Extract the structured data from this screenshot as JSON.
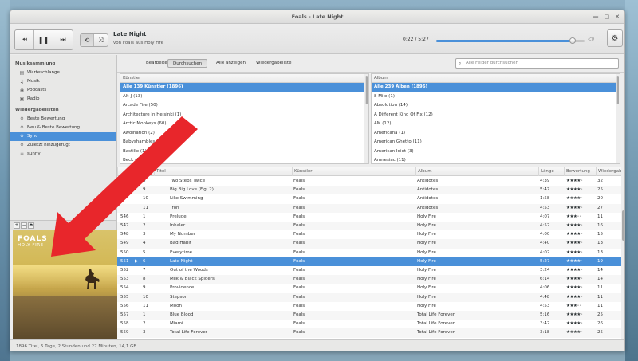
{
  "window": {
    "title": "Foals - Late Night"
  },
  "colors": {
    "accent": "#4a90d9",
    "arrow": "#e8262b"
  },
  "toolbar": {
    "now_playing_title": "Late Night",
    "now_playing_sub": "von Foals aus Holy Fire",
    "time": "0:22 / 5:27",
    "progress": 0.92
  },
  "sidebar": {
    "section1": "Musiksammlung",
    "library": [
      {
        "label": "Warteschlange",
        "icon": "queue-icon"
      },
      {
        "label": "Musik",
        "icon": "music-icon"
      },
      {
        "label": "Podcasts",
        "icon": "podcast-icon"
      },
      {
        "label": "Radio",
        "icon": "radio-icon"
      }
    ],
    "section2": "Wiedergabelisten",
    "playlists": [
      {
        "label": "Beste Bewertung",
        "icon": "smart-playlist-icon"
      },
      {
        "label": "Neu & Beste Bewertung",
        "icon": "smart-playlist-icon"
      },
      {
        "label": "Sync",
        "icon": "smart-playlist-icon",
        "selected": true
      },
      {
        "label": "Zuletzt hinzugefügt",
        "icon": "smart-playlist-icon"
      },
      {
        "label": "sunny",
        "icon": "playlist-icon"
      }
    ]
  },
  "cover": {
    "band": "FOALS",
    "album": "HOLY FIRE"
  },
  "filterbar": {
    "tabs": [
      "Bearbeiten",
      "Durchsuchen",
      "Alle anzeigen",
      "Wiedergabeliste"
    ],
    "active": 1,
    "search_placeholder": "Alle Felder durchsuchen"
  },
  "artists": {
    "header": "Künstler",
    "items": [
      "Alle 139 Künstler (1896)",
      "Alt-J (13)",
      "Arcade Fire (50)",
      "Architecture In Helsinki (1)",
      "Arctic Monkeys (60)",
      "Awolnation (2)",
      "Babyshambles (18)",
      "Bastille (1)",
      "Beck (1)",
      "Belle and Sebastian (13)"
    ]
  },
  "albums": {
    "header": "Album",
    "items": [
      "Alle 239 Alben (1896)",
      "8 Mile (1)",
      "Absolution (14)",
      "A Different Kind Of Fix (12)",
      "AM (12)",
      "Americana (1)",
      "American Ghetto (11)",
      "American Idiot (3)",
      "Amnesiac (11)",
      "Amnesia (1)"
    ]
  },
  "tracks": {
    "headers": [
      "",
      "Titel",
      "Titel",
      "Künstler",
      "Album",
      "Länge",
      "Bewertung",
      "Wiedergaben"
    ],
    "rows": [
      {
        "no": "",
        "tr": "8",
        "title": "Two Steps Twice",
        "artist": "Foals",
        "album": "Antidotes",
        "len": "4:39",
        "rating": 4,
        "plays": "32"
      },
      {
        "no": "",
        "tr": "9",
        "title": "Big Big Love (Fig. 2)",
        "artist": "Foals",
        "album": "Antidotes",
        "len": "5:47",
        "rating": 4,
        "plays": "25"
      },
      {
        "no": "",
        "tr": "10",
        "title": "Like Swimming",
        "artist": "Foals",
        "album": "Antidotes",
        "len": "1:58",
        "rating": 4,
        "plays": "20"
      },
      {
        "no": "",
        "tr": "11",
        "title": "Tron",
        "artist": "Foals",
        "album": "Antidotes",
        "len": "4:53",
        "rating": 4,
        "plays": "27"
      },
      {
        "no": "546",
        "tr": "1",
        "title": "Prelude",
        "artist": "Foals",
        "album": "Holy Fire",
        "len": "4:07",
        "rating": 3,
        "plays": "11"
      },
      {
        "no": "547",
        "tr": "2",
        "title": "Inhaler",
        "artist": "Foals",
        "album": "Holy Fire",
        "len": "4:52",
        "rating": 4,
        "plays": "16"
      },
      {
        "no": "548",
        "tr": "3",
        "title": "My Number",
        "artist": "Foals",
        "album": "Holy Fire",
        "len": "4:00",
        "rating": 4,
        "plays": "15"
      },
      {
        "no": "549",
        "tr": "4",
        "title": "Bad Habit",
        "artist": "Foals",
        "album": "Holy Fire",
        "len": "4:40",
        "rating": 4,
        "plays": "13"
      },
      {
        "no": "550",
        "tr": "5",
        "title": "Everytime",
        "artist": "Foals",
        "album": "Holy Fire",
        "len": "4:02",
        "rating": 4,
        "plays": "13"
      },
      {
        "no": "551",
        "tr": "6",
        "title": "Late Night",
        "artist": "Foals",
        "album": "Holy Fire",
        "len": "5:27",
        "rating": 4,
        "plays": "19",
        "selected": true,
        "playing": true
      },
      {
        "no": "552",
        "tr": "7",
        "title": "Out of the Woods",
        "artist": "Foals",
        "album": "Holy Fire",
        "len": "3:24",
        "rating": 4,
        "plays": "14"
      },
      {
        "no": "553",
        "tr": "8",
        "title": "Milk & Black Spiders",
        "artist": "Foals",
        "album": "Holy Fire",
        "len": "6:14",
        "rating": 4,
        "plays": "14"
      },
      {
        "no": "554",
        "tr": "9",
        "title": "Providence",
        "artist": "Foals",
        "album": "Holy Fire",
        "len": "4:06",
        "rating": 4,
        "plays": "11"
      },
      {
        "no": "555",
        "tr": "10",
        "title": "Stepson",
        "artist": "Foals",
        "album": "Holy Fire",
        "len": "4:48",
        "rating": 4,
        "plays": "11"
      },
      {
        "no": "556",
        "tr": "11",
        "title": "Moon",
        "artist": "Foals",
        "album": "Holy Fire",
        "len": "4:53",
        "rating": 3,
        "plays": "11"
      },
      {
        "no": "557",
        "tr": "1",
        "title": "Blue Blood",
        "artist": "Foals",
        "album": "Total Life Forever",
        "len": "5:16",
        "rating": 4,
        "plays": "25"
      },
      {
        "no": "558",
        "tr": "2",
        "title": "Miami",
        "artist": "Foals",
        "album": "Total Life Forever",
        "len": "3:42",
        "rating": 4,
        "plays": "26"
      },
      {
        "no": "559",
        "tr": "3",
        "title": "Total Life Forever",
        "artist": "Foals",
        "album": "Total Life Forever",
        "len": "3:18",
        "rating": 4,
        "plays": "25"
      },
      {
        "no": "560",
        "tr": "4",
        "title": "Black Gold",
        "artist": "Foals",
        "album": "Total Life Forever",
        "len": "4:07",
        "rating": 4,
        "plays": "33"
      }
    ]
  },
  "statusbar": {
    "text": "1896 Titel, 5 Tage, 2 Stunden und 27 Minuten, 14,1 GB"
  }
}
